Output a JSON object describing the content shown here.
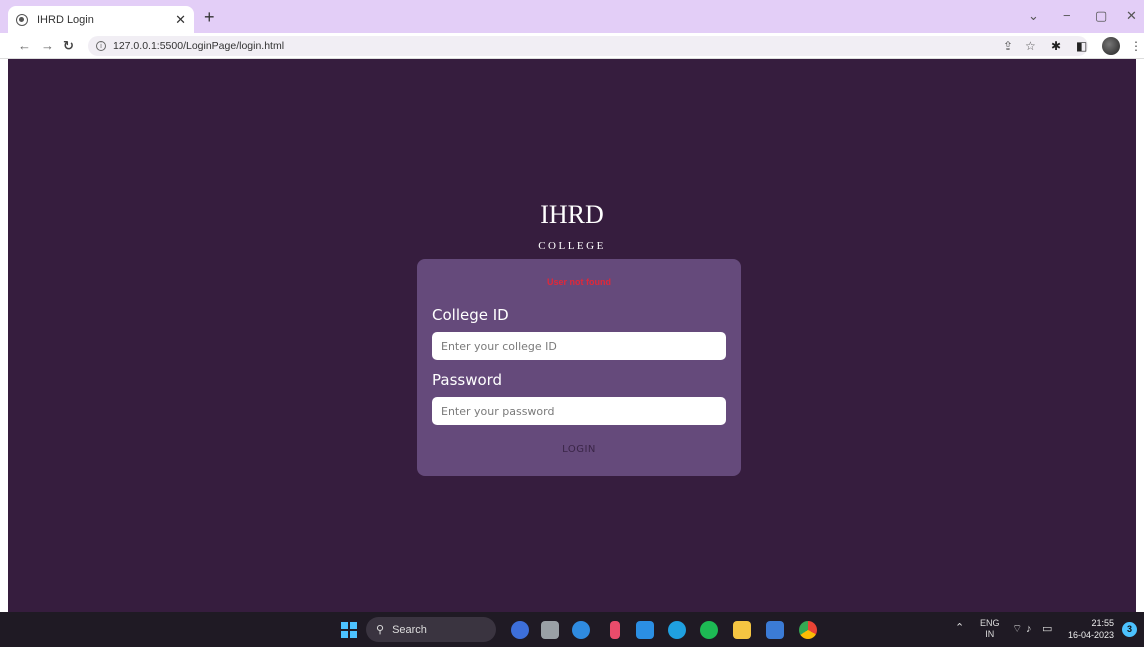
{
  "browser": {
    "tab_title": "IHRD Login",
    "url": "127.0.0.1:5500/LoginPage/login.html",
    "window_controls": [
      "chevron-down",
      "minimize",
      "maximize",
      "close"
    ]
  },
  "page": {
    "brand_title": "IHRD",
    "brand_subtitle": "COLLEGE",
    "error_message": "User not found",
    "college_id": {
      "label": "College ID",
      "placeholder": "Enter your college ID",
      "value": ""
    },
    "password": {
      "label": "Password",
      "placeholder": "Enter your password",
      "value": ""
    },
    "login_label": "LOGIN",
    "colors": {
      "background": "#361d3e",
      "card": "#654a7b",
      "error": "#e0283a"
    }
  },
  "taskbar": {
    "search_label": "Search",
    "language_top": "ENG",
    "language_bottom": "IN",
    "time": "21:55",
    "date": "16-04-2023",
    "notification_count": "3"
  }
}
